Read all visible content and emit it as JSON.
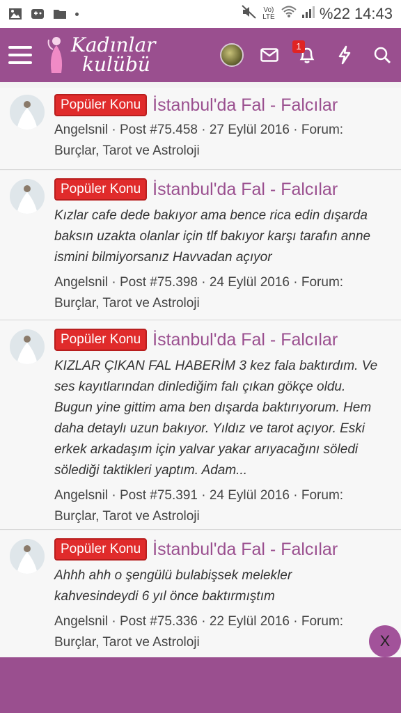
{
  "status_bar": {
    "battery": "%22",
    "time": "14:43",
    "network": "Vo) LTE",
    "icons": [
      "image-icon",
      "gamepad-icon",
      "folder-icon",
      "dot-icon",
      "mute-icon",
      "wifi-icon",
      "signal-icon"
    ]
  },
  "header": {
    "logo_line1": "Kadınlar",
    "logo_line2": "kulübü",
    "notification_count": "1",
    "icons": [
      "menu-icon",
      "avatar",
      "mail-icon",
      "bell-icon",
      "bolt-icon",
      "search-icon"
    ],
    "background_color": "#9a4f8f"
  },
  "posts": [
    {
      "tag": "Popüler Konu",
      "title": "İstanbul'da Fal - Falcılar",
      "snippet": "",
      "meta_line1": "Angelsnil · Post #75.458 · 27 Eylül 2016 · Forum:",
      "meta_line2": "Burçlar, Tarot ve Astroloji"
    },
    {
      "tag": "Popüler Konu",
      "title": "İstanbul'da Fal - Falcılar",
      "snippet_line1": "Kızlar cafe dede bakıyor ama bence rica edin dışarda",
      "snippet_line2": "baksın uzakta olanlar için tlf bakıyor karşı tarafın anne",
      "snippet_line3": "ismini bilmiyorsanız Havvadan açıyor",
      "meta_line1": "Angelsnil · Post #75.398 · 24 Eylül 2016 · Forum:",
      "meta_line2": "Burçlar, Tarot ve Astroloji"
    },
    {
      "tag": "Popüler Konu",
      "title": "İstanbul'da Fal - Falcılar",
      "snippet_line1": "KIZLAR ÇIKAN FAL HABERİM 3 kez fala baktırdım. Ve",
      "snippet_line2": "ses kayıtlarından dinlediğim falı çıkan gökçe oldu.",
      "snippet_line3": "Bugun yine gittim ama ben dışarda baktırıyorum. Hem",
      "snippet_line4": "daha detaylı uzun bakıyor. Yıldız ve tarot açıyor. Eski",
      "snippet_line5": "erkek arkadaşım için yalvar yakar arıyacağını söledi",
      "snippet_line6": "sölediği taktikleri yaptım. Adam...",
      "meta_line1": "Angelsnil · Post #75.391 · 24 Eylül 2016 · Forum:",
      "meta_line2": "Burçlar, Tarot ve Astroloji"
    },
    {
      "tag": "Popüler Konu",
      "title": "İstanbul'da Fal - Falcılar",
      "snippet_line1": "Ahhh ahh o şengülü bulabişsek melekler",
      "snippet_line2": "kahvesindeydi 6 yıl önce baktırmıştım",
      "meta_line1": "Angelsnil · Post #75.336 · 22 Eylül 2016 · Forum:",
      "meta_line2": "Burçlar, Tarot ve Astroloji"
    }
  ],
  "close_button": {
    "label": "X"
  },
  "colors": {
    "brand": "#9a4f8f",
    "tag_red": "#e02b2b",
    "title_purple": "#9a4f8f"
  }
}
